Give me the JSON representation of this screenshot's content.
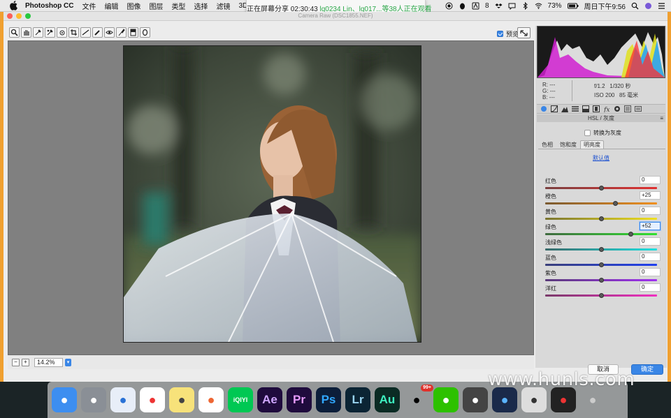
{
  "menubar": {
    "app_name": "Photoshop CC",
    "menus": [
      "文件",
      "编辑",
      "图像",
      "图层",
      "类型",
      "选择",
      "滤镜",
      "3D"
    ],
    "ime_label": "8",
    "battery": "73%",
    "clock": "周日下午9:56"
  },
  "share_banner": {
    "prefix": "正在屏幕分享 02:30:43",
    "viewers": "lq0234 Lin、lq017...等38人正在观看"
  },
  "dialog": {
    "title": "Camera Raw (DSC1855.NEF)",
    "tools": [
      "zoom-icon",
      "hand-icon",
      "white-balance-icon",
      "color-sampler-icon",
      "target-adjust-icon",
      "crop-icon",
      "straighten-icon",
      "spot-removal-icon",
      "red-eye-icon",
      "adjustment-brush-icon",
      "graduated-filter-icon",
      "radial-filter-icon"
    ],
    "preview_label": "预览",
    "preview_checked": true,
    "zoom": "14.2%",
    "cancel_label": "取消",
    "ok_label": "确定"
  },
  "panel": {
    "rgb": {
      "r_label": "R:",
      "r_value": "---",
      "g_label": "G:",
      "g_value": "---",
      "b_label": "B:",
      "b_value": "---"
    },
    "exif": {
      "aperture": "f/1.2",
      "shutter": "1/320 秒",
      "iso": "ISO 200",
      "focal": "85 毫米"
    },
    "section_title": "HSL / 灰度",
    "convert_label": "转换为灰度",
    "subtabs": [
      "色相",
      "饱和度",
      "明亮度"
    ],
    "active_subtab": 2,
    "default_link": "默认值",
    "sliders": [
      {
        "label": "红色",
        "value": "0",
        "level": 0,
        "gradient": "linear-gradient(90deg,#7a4040,#e03030)"
      },
      {
        "label": "橙色",
        "value": "+25",
        "level": 25,
        "gradient": "linear-gradient(90deg,#7a5a30,#f09020)"
      },
      {
        "label": "黄色",
        "value": "0",
        "level": 0,
        "gradient": "linear-gradient(90deg,#7a7530,#f0e020)"
      },
      {
        "label": "绿色",
        "value": "+52",
        "level": 52,
        "gradient": "linear-gradient(90deg,#3f6a3f,#30e030)",
        "focus": true
      },
      {
        "label": "浅绿色",
        "value": "0",
        "level": 0,
        "gradient": "linear-gradient(90deg,#3a6a6a,#20e0e0)"
      },
      {
        "label": "蓝色",
        "value": "0",
        "level": 0,
        "gradient": "linear-gradient(90deg,#3a3f7a,#2040f0)"
      },
      {
        "label": "紫色",
        "value": "0",
        "level": 0,
        "gradient": "linear-gradient(90deg,#5a3a7a,#a030f0)"
      },
      {
        "label": "洋红",
        "value": "0",
        "level": 0,
        "gradient": "linear-gradient(90deg,#7a3a6a,#f030c0)"
      }
    ]
  },
  "dock": {
    "apps": [
      {
        "name": "finder-icon",
        "label": "",
        "bg": "#3d8ef0",
        "fg": "#fff"
      },
      {
        "name": "launchpad-icon",
        "label": "",
        "bg": "#8a8f96",
        "fg": "#fff"
      },
      {
        "name": "safari-icon",
        "label": "",
        "bg": "#e8eef8",
        "fg": "#2a72d6"
      },
      {
        "name": "reminders-icon",
        "label": "",
        "bg": "#ffffff",
        "fg": "#e33"
      },
      {
        "name": "notes-icon",
        "label": "",
        "bg": "#f7e27a",
        "fg": "#444"
      },
      {
        "name": "photos-icon",
        "label": "",
        "bg": "#ffffff",
        "fg": "#e63"
      },
      {
        "name": "iqiyi-icon",
        "label": "iQIYI",
        "bg": "#00c853",
        "fg": "#fff"
      },
      {
        "name": "after-effects-icon",
        "label": "Ae",
        "bg": "#1f0b3d",
        "fg": "#cfa6ff"
      },
      {
        "name": "premiere-icon",
        "label": "Pr",
        "bg": "#1f0b3d",
        "fg": "#e79bff"
      },
      {
        "name": "photoshop-icon",
        "label": "Ps",
        "bg": "#0c1e3a",
        "fg": "#31a8ff"
      },
      {
        "name": "lightroom-icon",
        "label": "Lr",
        "bg": "#0b2434",
        "fg": "#9ad4f0"
      },
      {
        "name": "audition-icon",
        "label": "Au",
        "bg": "#0b2b24",
        "fg": "#3ef0c0"
      },
      {
        "name": "qq-icon",
        "label": "",
        "bg": "transparent",
        "fg": "#000",
        "badge": "99+"
      },
      {
        "name": "wechat-icon",
        "label": "",
        "bg": "#2dc100",
        "fg": "#fff"
      },
      {
        "name": "screenshot-app-icon",
        "label": "",
        "bg": "#444",
        "fg": "#fff"
      },
      {
        "name": "quicktime-icon",
        "label": "",
        "bg": "#1a2a4a",
        "fg": "#5ab4ff"
      },
      {
        "name": "preview-icon",
        "label": "",
        "bg": "#ddd",
        "fg": "#333"
      },
      {
        "name": "photo-booth-icon",
        "label": "",
        "bg": "#222",
        "fg": "#e33"
      },
      {
        "name": "trash-icon",
        "label": "",
        "bg": "transparent",
        "fg": "#ccc"
      }
    ]
  },
  "watermark": "www.hunls.com",
  "colors": {
    "accent": "#3a86e6",
    "frame": "#f0a030",
    "share_green": "#2ca84a"
  }
}
